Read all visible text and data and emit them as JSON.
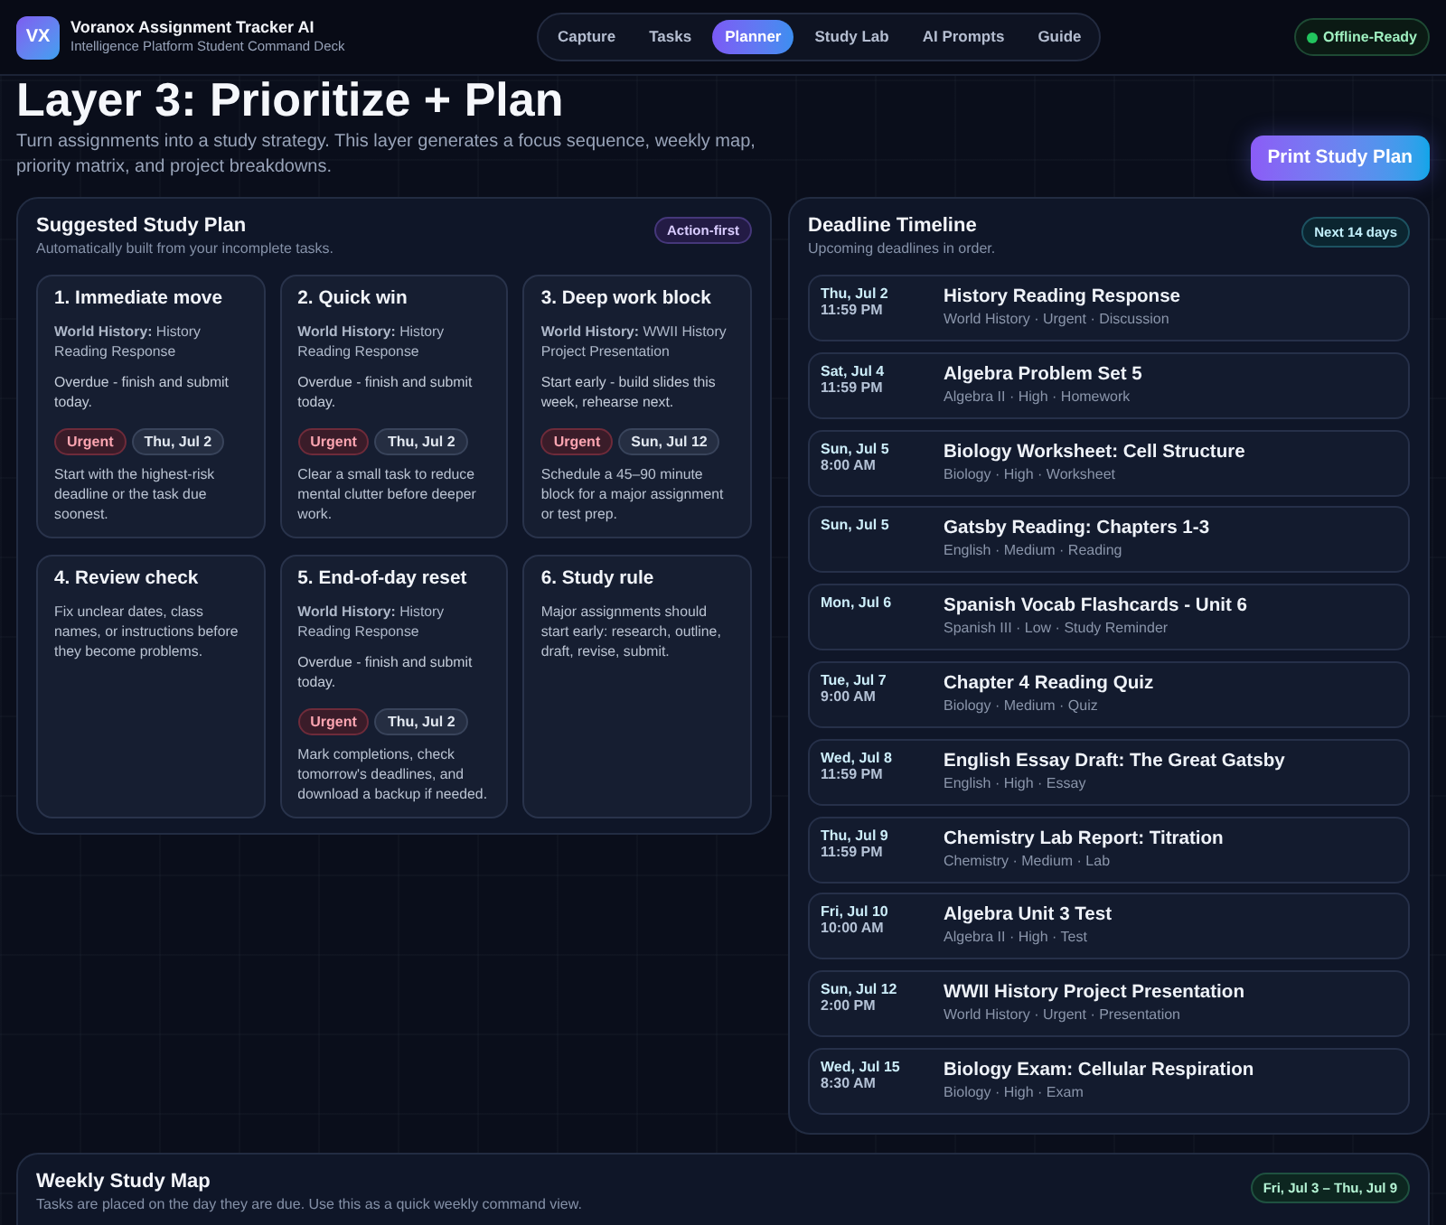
{
  "app": {
    "logo": "VX",
    "title": "Voranox Assignment Tracker AI",
    "subtitle": "Intelligence Platform Student Command Deck"
  },
  "nav": [
    {
      "label": "Capture",
      "selected": false
    },
    {
      "label": "Tasks",
      "selected": false
    },
    {
      "label": "Planner",
      "selected": true
    },
    {
      "label": "Study Lab",
      "selected": false
    },
    {
      "label": "AI Prompts",
      "selected": false
    },
    {
      "label": "Guide",
      "selected": false
    }
  ],
  "status_badge": {
    "label": "Offline-Ready"
  },
  "page": {
    "title": "Layer 3: Prioritize + Plan",
    "description": "Turn assignments into a study strategy. This layer generates a focus sequence, weekly map, priority matrix, and project breakdowns.",
    "action": "Print Study Plan"
  },
  "study_plan": {
    "title": "Suggested Study Plan",
    "subtitle": "Automatically built from your incomplete tasks.",
    "badge": "Action-first",
    "cards": [
      {
        "title": "1. Immediate move",
        "task": "**World History:** History Reading Response",
        "status": "Overdue - finish and submit today.",
        "tags": [
          {
            "label": "Urgent",
            "kind": "priority"
          },
          {
            "label": "Thu, Jul 2",
            "kind": "date"
          }
        ],
        "note": "Start with the highest-risk deadline or the task due soonest."
      },
      {
        "title": "2. Quick win",
        "task": "**World History:** History Reading Response",
        "status": "Overdue - finish and submit today.",
        "tags": [
          {
            "label": "Urgent",
            "kind": "priority"
          },
          {
            "label": "Thu, Jul 2",
            "kind": "date"
          }
        ],
        "note": "Clear a small task to reduce mental clutter before deeper work."
      },
      {
        "title": "3. Deep work block",
        "task": "**World History:** WWII History Project Presentation",
        "status": "Start early - build slides this week, rehearse next.",
        "tags": [
          {
            "label": "Urgent",
            "kind": "priority"
          },
          {
            "label": "Sun, Jul 12",
            "kind": "date"
          }
        ],
        "note": "Schedule a 45–90 minute block for a major assignment or test prep."
      },
      {
        "title": "4. Review check",
        "note": "Fix unclear dates, class names, or instructions before they become problems."
      },
      {
        "title": "5. End-of-day reset",
        "task": "**World History:** History Reading Response",
        "status": "Overdue - finish and submit today.",
        "tags": [
          {
            "label": "Urgent",
            "kind": "priority"
          },
          {
            "label": "Thu, Jul 2",
            "kind": "date"
          }
        ],
        "note": "Mark completions, check tomorrow's deadlines, and download a backup if needed."
      },
      {
        "title": "6. Study rule",
        "note": "Major assignments should start early: research, outline, draft, revise, submit."
      }
    ]
  },
  "timeline": {
    "title": "Deadline Timeline",
    "subtitle": "Upcoming deadlines in order.",
    "badge": "Next 14 days",
    "items": [
      {
        "date": "Thu, Jul 2",
        "time": "11:59 PM",
        "title": "History Reading Response",
        "meta": "World History · Urgent · Discussion"
      },
      {
        "date": "Sat, Jul 4",
        "time": "11:59 PM",
        "title": "Algebra Problem Set 5",
        "meta": "Algebra II · High · Homework"
      },
      {
        "date": "Sun, Jul 5",
        "time": "8:00 AM",
        "title": "Biology Worksheet: Cell Structure",
        "meta": "Biology · High · Worksheet"
      },
      {
        "date": "Sun, Jul 5",
        "title": "Gatsby Reading: Chapters 1-3",
        "meta": "English · Medium · Reading"
      },
      {
        "date": "Mon, Jul 6",
        "title": "Spanish Vocab Flashcards - Unit 6",
        "meta": "Spanish III · Low · Study Reminder"
      },
      {
        "date": "Tue, Jul 7",
        "time": "9:00 AM",
        "title": "Chapter 4 Reading Quiz",
        "meta": "Biology · Medium · Quiz"
      },
      {
        "date": "Wed, Jul 8",
        "time": "11:59 PM",
        "title": "English Essay Draft: The Great Gatsby",
        "meta": "English · High · Essay"
      },
      {
        "date": "Thu, Jul 9",
        "time": "11:59 PM",
        "title": "Chemistry Lab Report: Titration",
        "meta": "Chemistry · Medium · Lab"
      },
      {
        "date": "Fri, Jul 10",
        "time": "10:00 AM",
        "title": "Algebra Unit 3 Test",
        "meta": "Algebra II · High · Test"
      },
      {
        "date": "Sun, Jul 12",
        "time": "2:00 PM",
        "title": "WWII History Project Presentation",
        "meta": "World History · Urgent · Presentation"
      },
      {
        "date": "Wed, Jul 15",
        "time": "8:30 AM",
        "title": "Biology Exam: Cellular Respiration",
        "meta": "Biology · High · Exam"
      }
    ]
  },
  "weekly_map": {
    "title": "Weekly Study Map",
    "subtitle": "Tasks are placed on the day they are due. Use this as a quick weekly command view.",
    "badge": "Fri, Jul 3 – Thu, Jul 9"
  }
}
